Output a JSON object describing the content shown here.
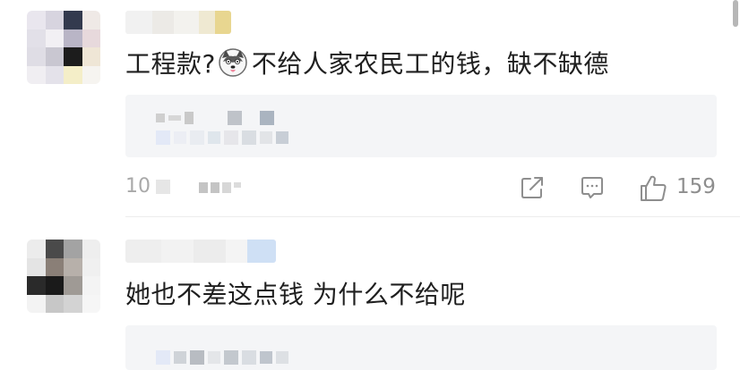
{
  "comments": [
    {
      "text_before_emoji": "工程款?",
      "emoji": "husky-emoji",
      "text_after_emoji": "不给人家农民工的钱，缺不缺德",
      "time_prefix": "10",
      "share_icon": "share-icon",
      "reply_icon": "comment-icon",
      "like_icon": "thumbs-up-icon",
      "like_count": "159"
    },
    {
      "text": "她也不差这点钱 为什么不给呢"
    }
  ],
  "colors": {
    "text": "#1f1f1f",
    "meta": "#a9a9a9",
    "reply_bg": "#f4f5f7",
    "icon": "#8e8e8e"
  }
}
